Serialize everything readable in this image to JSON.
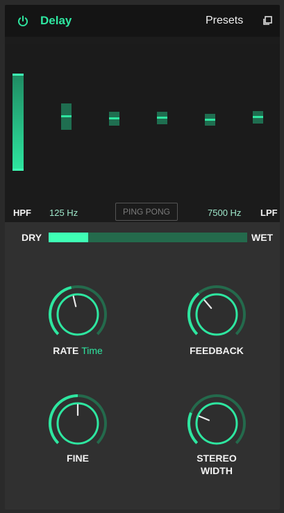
{
  "header": {
    "title": "Delay",
    "presets_label": "Presets",
    "power_icon": "power-icon",
    "copy_icon": "copy-icon"
  },
  "filter": {
    "hpf_label": "HPF",
    "hpf_value": "125 Hz",
    "lpf_label": "LPF",
    "lpf_value": "7500 Hz",
    "ping_pong_label": "PING PONG"
  },
  "mix": {
    "dry_label": "DRY",
    "wet_label": "WET",
    "level": 0.2
  },
  "knobs": {
    "rate": {
      "label": "RATE",
      "sub": "Time",
      "level": 0.45
    },
    "feedback": {
      "label": "FEEDBACK",
      "level": 0.35
    },
    "fine": {
      "label": "FINE",
      "level": 0.5
    },
    "stereo_width": {
      "label_line1": "STEREO",
      "label_line2": "WIDTH",
      "level": 0.25
    }
  },
  "colors": {
    "accent": "#2ee6a0",
    "accent_bright": "#3fffb5",
    "accent_dim": "#246a4c",
    "panel": "#303030",
    "header": "#141414"
  }
}
